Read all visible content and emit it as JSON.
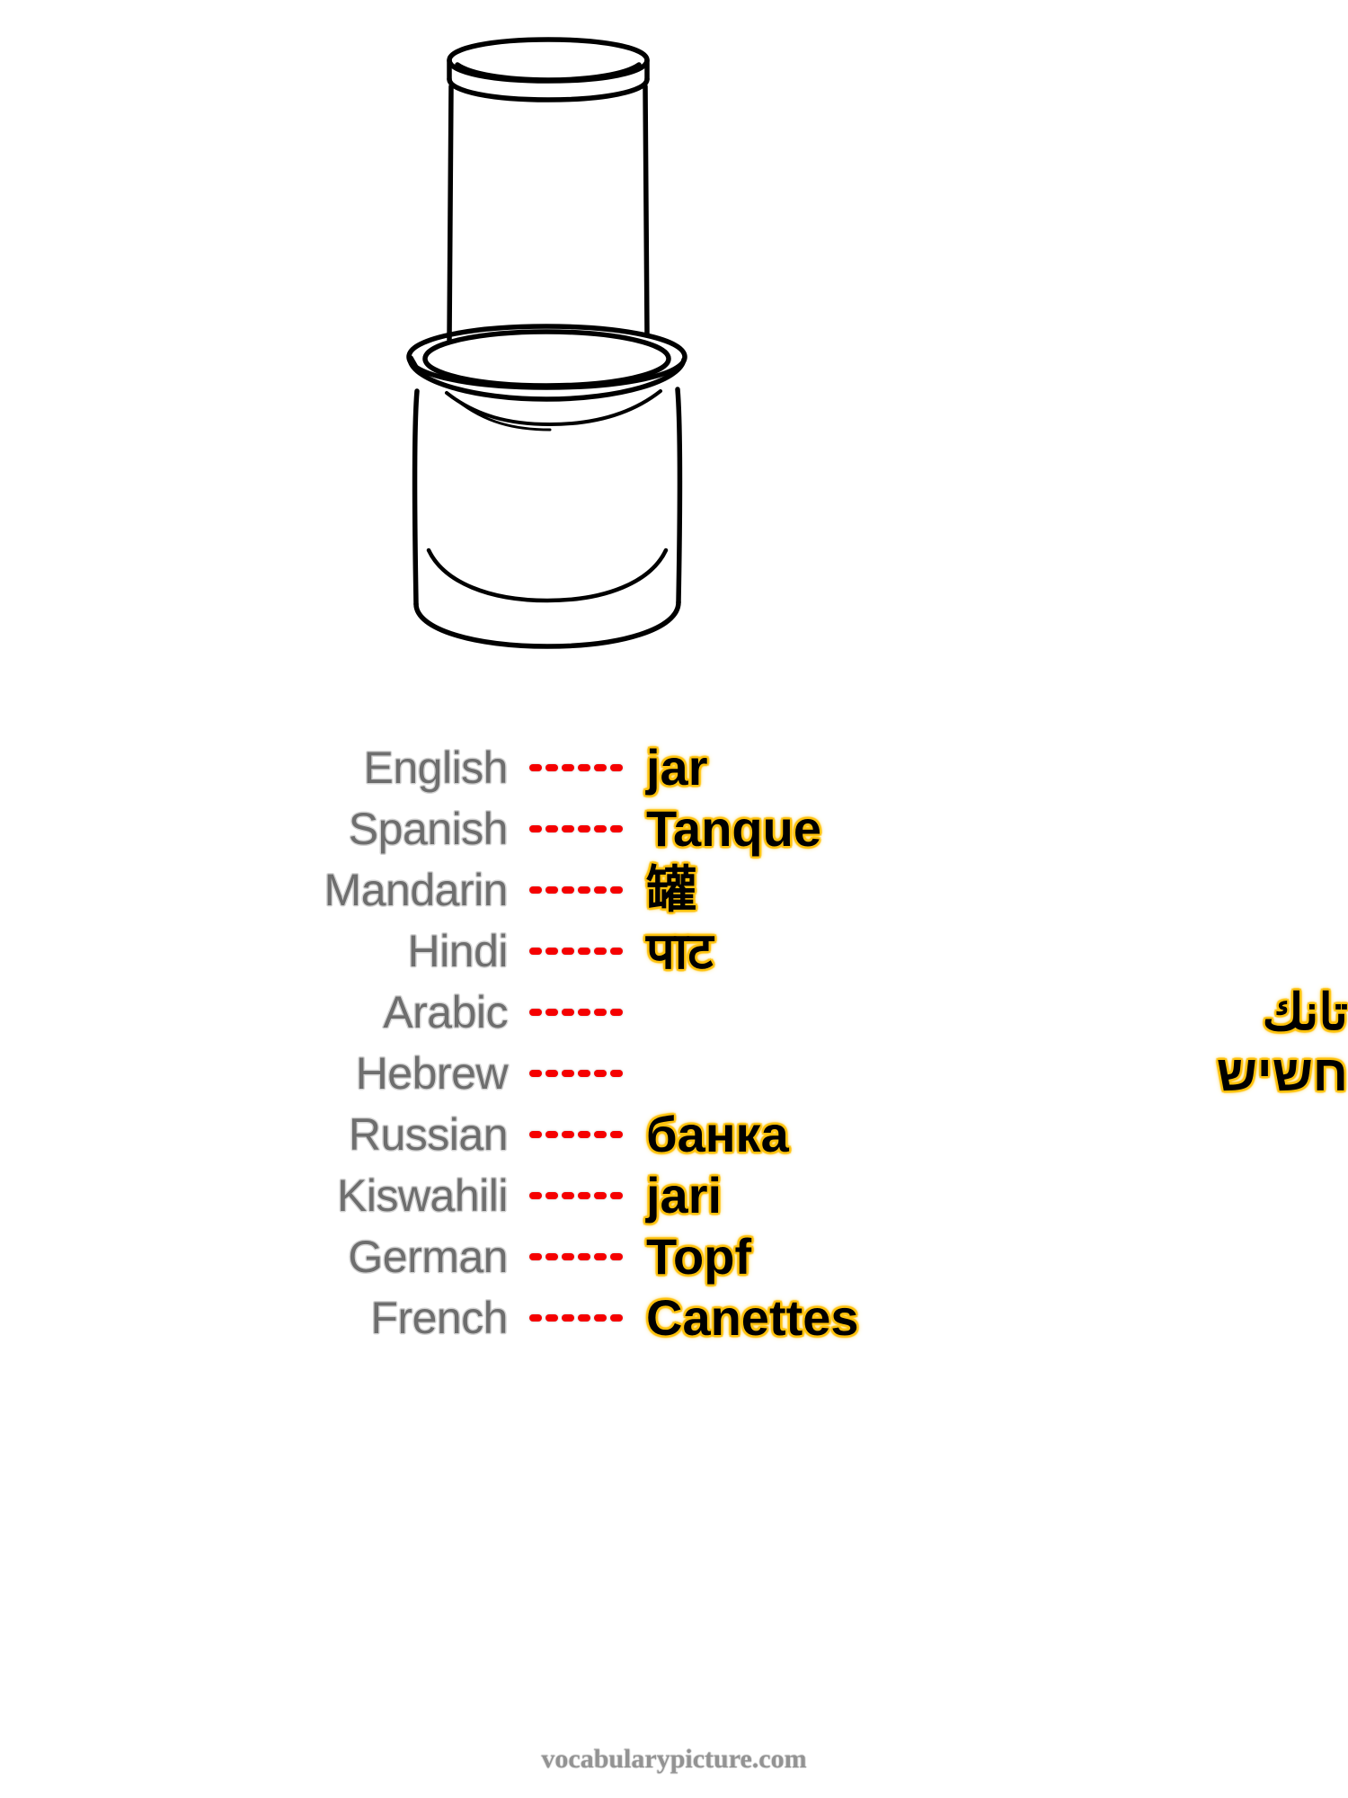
{
  "illustration": {
    "name": "jar-line-drawing",
    "subject": "jar",
    "style": "black-outline-line-art",
    "stroke_color": "#000000",
    "background_color": "#ffffff"
  },
  "vocabulary": {
    "separator_dash_count": 6,
    "colors": {
      "label": "#6e6e6e",
      "label_outline": "#d4d4d4",
      "dash": "#f50000",
      "word": "#000000",
      "word_glow": "#ffc20e"
    },
    "rows": [
      {
        "language": "English",
        "word": "jar",
        "rtl": false
      },
      {
        "language": "Spanish",
        "word": "Tanque",
        "rtl": false
      },
      {
        "language": "Mandarin",
        "word": "罐",
        "rtl": false
      },
      {
        "language": "Hindi",
        "word": "पाट",
        "rtl": false
      },
      {
        "language": "Arabic",
        "word": "تانك",
        "rtl": true
      },
      {
        "language": "Hebrew",
        "word": "חשיש",
        "rtl": true
      },
      {
        "language": "Russian",
        "word": "банка",
        "rtl": false
      },
      {
        "language": "Kiswahili",
        "word": "jari",
        "rtl": false
      },
      {
        "language": "German",
        "word": "Topf",
        "rtl": false
      },
      {
        "language": "French",
        "word": "Canettes",
        "rtl": false
      }
    ]
  },
  "footer": {
    "site": "vocabularypicture.com"
  }
}
